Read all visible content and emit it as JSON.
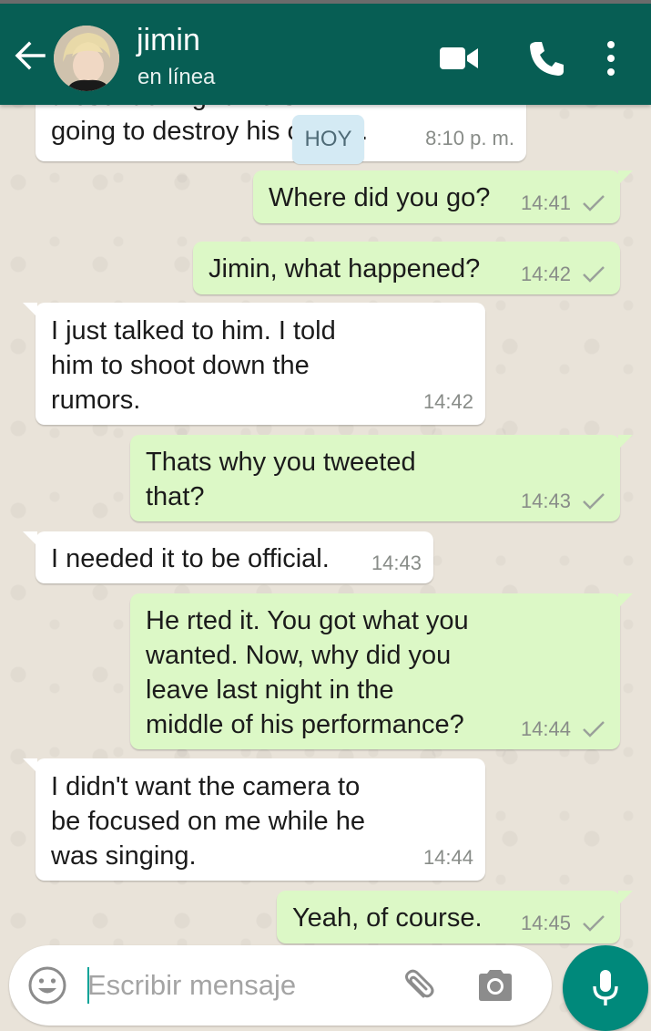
{
  "header": {
    "contact_name": "jimin",
    "status": "en línea"
  },
  "day_divider": "HOY",
  "messages": [
    {
      "direction": "in",
      "text": "those fucking rumors I'm\ngoing to destroy his career.",
      "time": "8:10 p. m.",
      "partially_hidden": true
    },
    {
      "direction": "out",
      "text": "Where did you go?",
      "time": "14:41",
      "status": "sent-check"
    },
    {
      "direction": "out",
      "text": "Jimin, what happened?",
      "time": "14:42",
      "status": "sent-check"
    },
    {
      "direction": "in",
      "text": "I just talked to him. I told\nhim to shoot down the\nrumors.",
      "time": "14:42"
    },
    {
      "direction": "out",
      "text": "Thats why you tweeted\nthat?",
      "time": "14:43",
      "status": "sent-check"
    },
    {
      "direction": "in",
      "text": "I needed it to be official.",
      "time": "14:43"
    },
    {
      "direction": "out",
      "text": "He rted it. You got what you\nwanted. Now, why did you\nleave last night in the\nmiddle of his performance?",
      "time": "14:44",
      "status": "sent-check"
    },
    {
      "direction": "in",
      "text": "I didn't want the camera to\nbe focused on me while he\nwas singing.",
      "time": "14:44"
    },
    {
      "direction": "out",
      "text": "Yeah, of course.",
      "time": "14:45",
      "status": "sent-check"
    }
  ],
  "composer": {
    "placeholder": "Escribir mensaje",
    "value": ""
  },
  "icons": {
    "back": "arrow-left-icon",
    "video_call": "video-camera-icon",
    "voice_call": "phone-icon",
    "menu": "more-vertical-icon",
    "emoji": "smiley-icon",
    "attach": "paperclip-icon",
    "camera": "camera-icon",
    "mic": "microphone-icon"
  },
  "colors": {
    "header": "#075e54",
    "outgoing_bubble": "#dcf8c6",
    "incoming_bubble": "#ffffff",
    "mic_button": "#00897b",
    "chat_background": "#e9e3d9"
  }
}
